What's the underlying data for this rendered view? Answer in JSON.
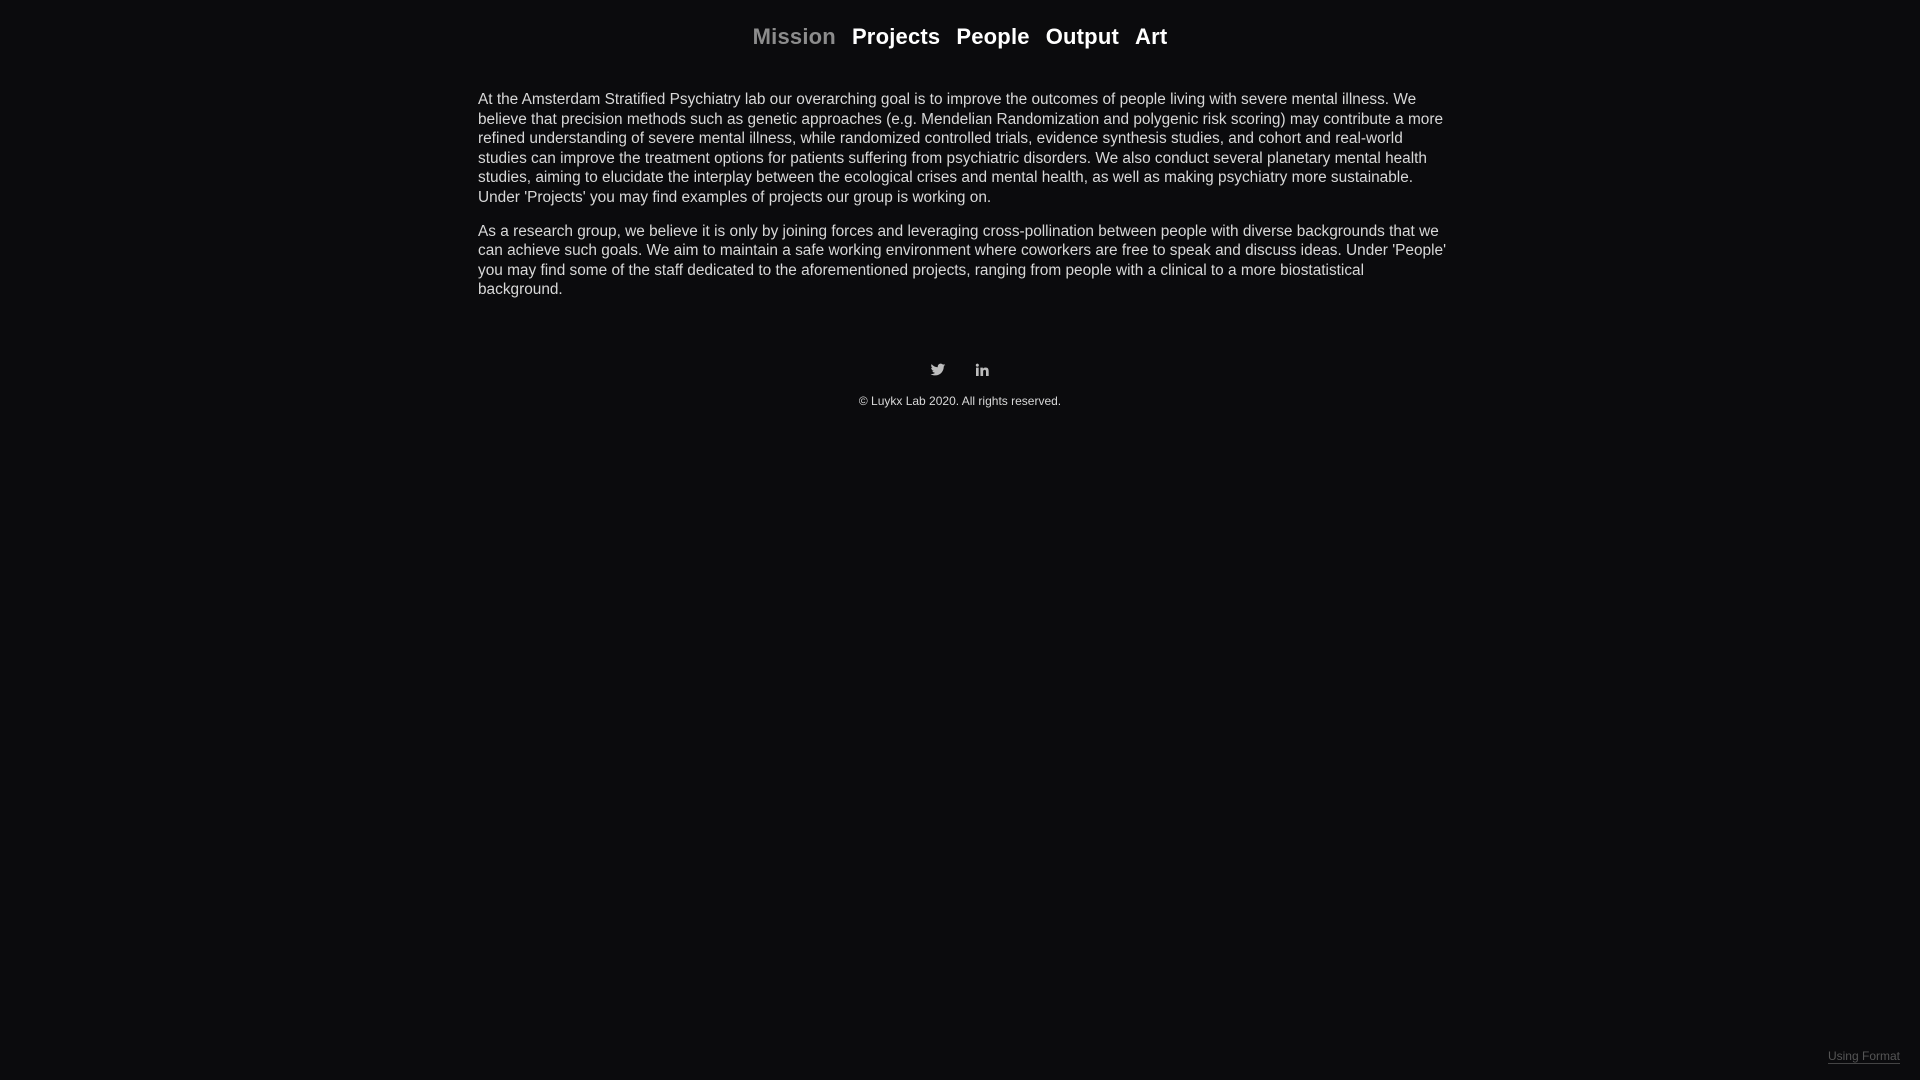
{
  "nav": {
    "items": [
      {
        "label": "Mission",
        "active": true
      },
      {
        "label": "Projects",
        "active": false
      },
      {
        "label": "People",
        "active": false
      },
      {
        "label": "Output",
        "active": false
      },
      {
        "label": "Art",
        "active": false
      }
    ]
  },
  "content": {
    "paragraphs": [
      "At the Amsterdam Stratified Psychiatry lab our overarching goal is to improve the outcomes of people living with severe mental illness. We believe that precision methods such as genetic approaches (e.g. Mendelian Randomization and polygenic risk scoring) may contribute a more refined understanding of severe mental illness, while randomized controlled trials, evidence synthesis studies, and cohort and real-world studies can improve the treatment options for patients suffering from psychiatric disorders. We also conduct several planetary mental health studies, aiming to elucidate the interplay between the ecological crises and mental health, as well as making psychiatry more sustainable. Under 'Projects' you may find examples of projects our group is working on.",
      "As a research group, we believe it is only by joining forces and leveraging cross-pollination between people with diverse backgrounds that we can achieve such goals. We aim to maintain a safe working environment where coworkers are free to speak and discuss ideas. Under 'People' you may find some of the staff dedicated to the aforementioned projects, ranging from people with a clinical to a more biostatistical background."
    ]
  },
  "social": {
    "icons": [
      "twitter-icon",
      "linkedin-icon"
    ]
  },
  "footer": {
    "copyright": "© Luykx Lab 2020. All rights reserved.",
    "using_format": "Using Format"
  },
  "colors": {
    "background": "#0b0b0d",
    "nav_active": "#8c8c8c",
    "nav_text": "#ffffff",
    "body_text": "#d8d8d8"
  }
}
